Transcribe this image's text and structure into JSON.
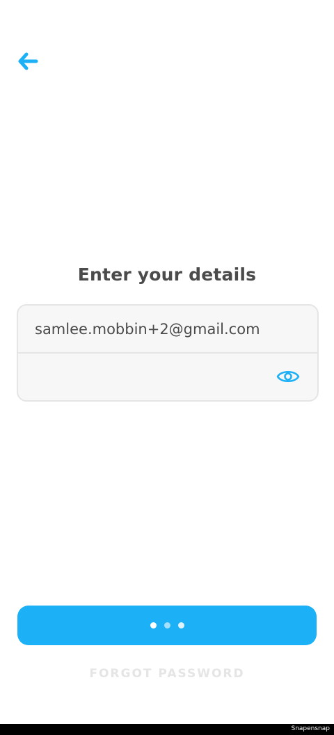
{
  "header": {
    "back_icon": "arrow-left-icon",
    "accent": "#1cb0f6"
  },
  "title": "Enter your details",
  "form": {
    "email_value": "samlee.mobbin+2@gmail.com",
    "password_value": "",
    "password_toggle_icon": "eye-icon"
  },
  "submit": {
    "state": "loading",
    "color": "#1cb0f6"
  },
  "forgot_password": "FORGOT PASSWORD",
  "watermark": "Snapensnap"
}
